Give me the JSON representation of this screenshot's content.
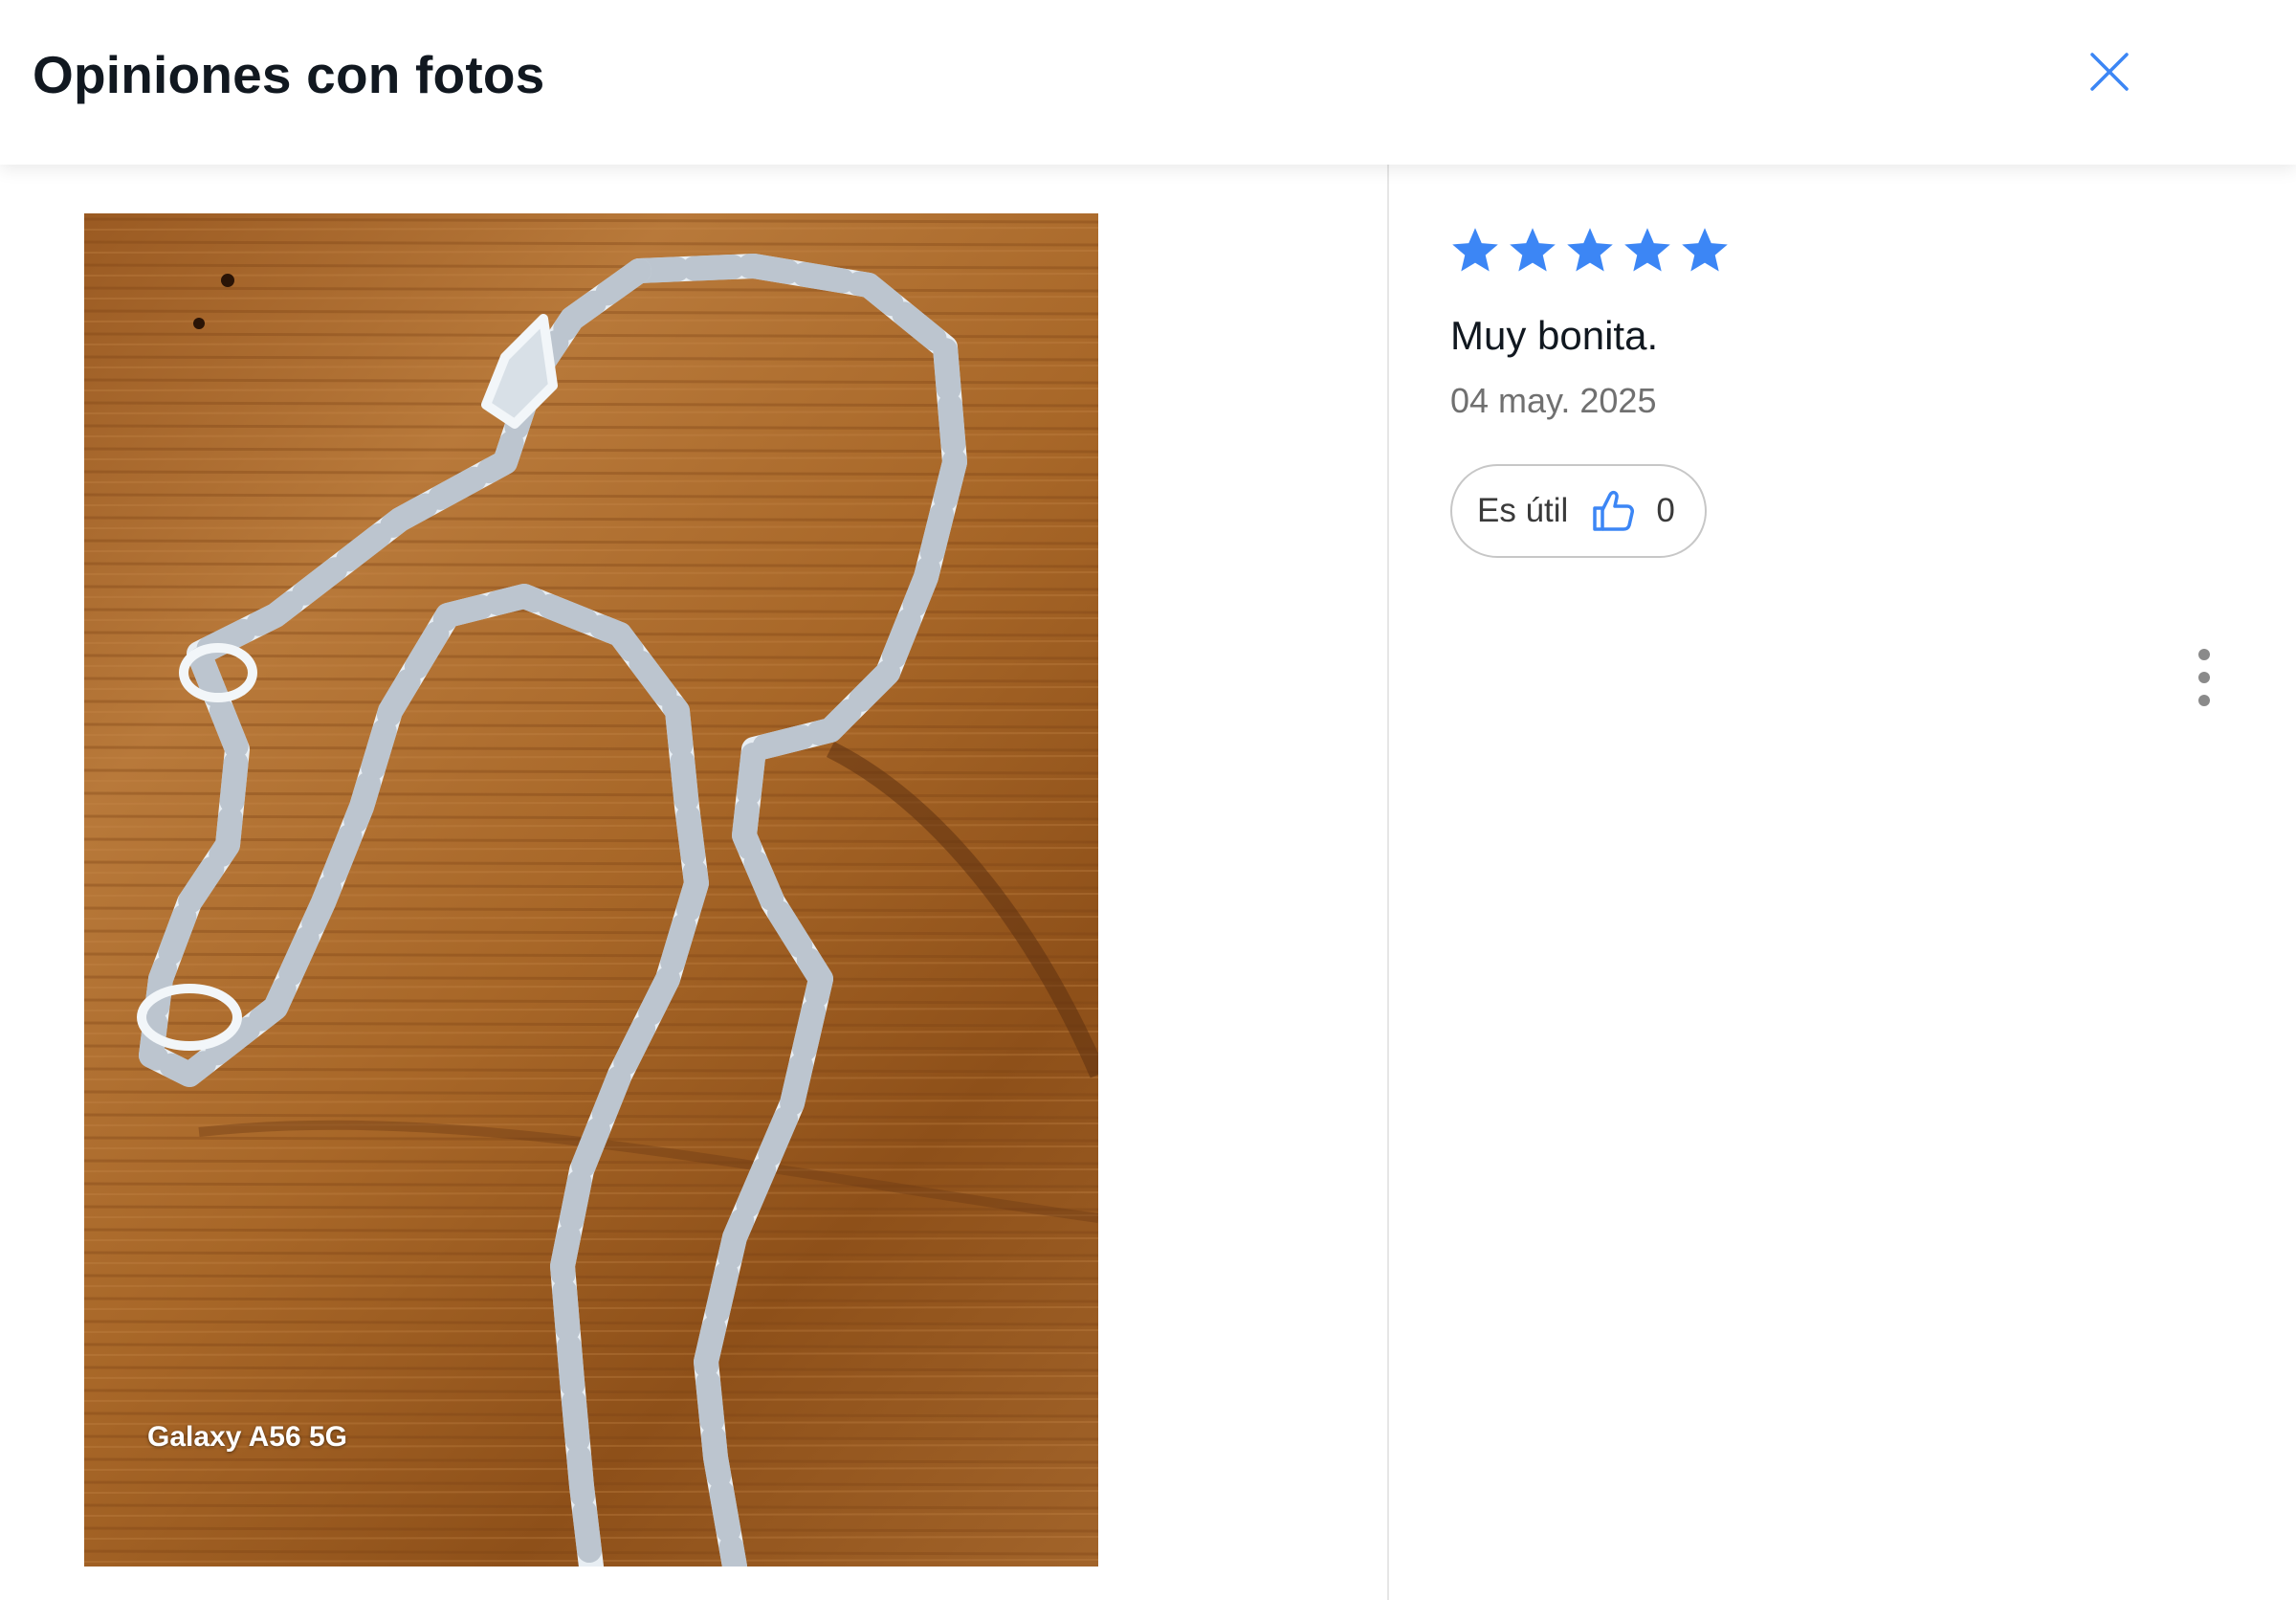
{
  "header": {
    "title": "Opiniones con fotos",
    "close_icon": "close-icon"
  },
  "photo": {
    "watermark": "Galaxy A56 5G"
  },
  "review": {
    "rating": 5,
    "rating_max": 5,
    "star_color": "#3c86f5",
    "title": "Muy bonita.",
    "date": "04 may. 2025",
    "helpful_label": "Es útil",
    "helpful_icon": "thumbs-up-icon",
    "helpful_count": "0",
    "more_icon": "more-vertical-icon"
  },
  "colors": {
    "accent": "#3c86f5",
    "close_icon": "#3c86f5"
  }
}
